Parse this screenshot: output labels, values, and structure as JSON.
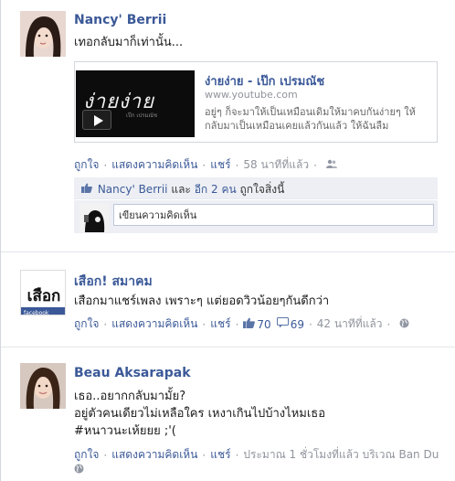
{
  "posts": [
    {
      "author": "Nancy' Berrii",
      "message": "เทอกลับมาก็เท่านั้น...",
      "attachment": {
        "thumb_title": "ง่ายง่าย",
        "thumb_sub": "เป๊ก เปรมณัช",
        "title": "ง่ายง่าย - เป๊ก เปรมณัช",
        "url": "www.youtube.com",
        "description": "อยู่ๆ ก็จะมาให้เป็นเหมือนเดิมให้มาคบกันง่ายๆ ให้กลับมาเป็นเหมือนเคยแล้วกันแล้ว ให้ฉันลืม"
      },
      "actions": {
        "like": "ถูกใจ",
        "comment": "แสดงความคิดเห็น",
        "share": "แชร์",
        "time": "58 นาทีที่แล้ว",
        "privacy_icon": "friends-icon"
      },
      "likes": {
        "names": "Nancy' Berrii",
        "and": "และ",
        "others": "อีก 2 คน",
        "suffix": "ถูกใจสิ่งนี้"
      },
      "comment_placeholder": "เขียนความคิดเห็น"
    },
    {
      "author": "เสือก! สมาคม",
      "message": "เสือกมาแชร์เพลง เพราะๆ แต่ยอดวิวน้อยๆกันดีกว่า",
      "avatar_text": "เสือก",
      "avatar_sub": "facebook",
      "actions": {
        "like": "ถูกใจ",
        "comment": "แสดงความคิดเห็น",
        "share": "แชร์",
        "like_count": "70",
        "comment_count": "69",
        "time": "42 นาทีที่แล้ว",
        "privacy_icon": "globe-icon"
      }
    },
    {
      "author": "Beau Aksarapak",
      "message_lines": [
        "เธอ..อยากกลับมามั้ย?",
        "อยู่ตัวคนเดียวไม่เหลือใคร เหงาเกินไปบ้างไหมเธอ",
        "#หนาวนะเห้ยยย ;'("
      ],
      "actions": {
        "like": "ถูกใจ",
        "comment": "แสดงความคิดเห็น",
        "share": "แชร์",
        "time": "ประมาณ 1 ชั่วโมงที่แล้ว บริเวณ Ban Du",
        "privacy_icon": "globe-icon"
      }
    }
  ],
  "separator": "·",
  "colors": {
    "link": "#3b5998",
    "muted": "#90949c",
    "ufi_bg": "#edeff4"
  }
}
